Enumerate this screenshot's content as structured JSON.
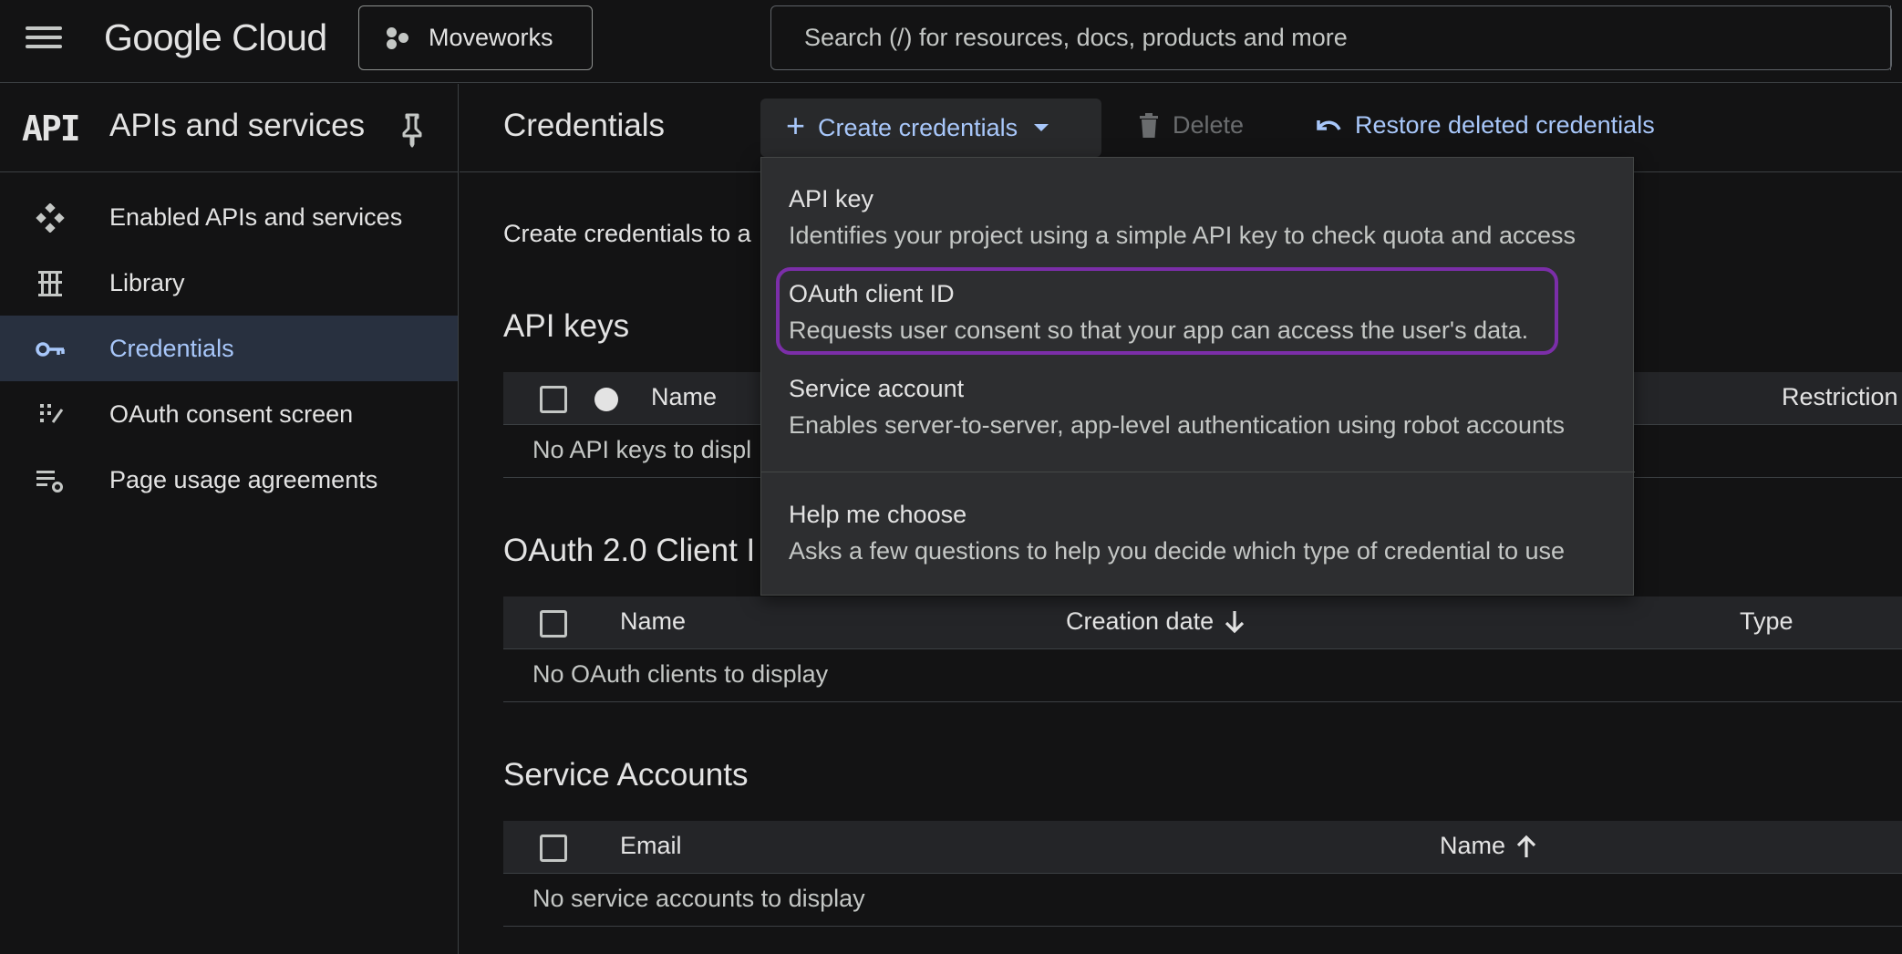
{
  "topbar": {
    "logo": "Google Cloud",
    "project": "Moveworks",
    "search_placeholder": "Search (/) for resources, docs, products and more"
  },
  "sidebar": {
    "badge": "API",
    "title": "APIs and services",
    "items": [
      {
        "label": "Enabled APIs and services",
        "icon": "diamond-grid-icon"
      },
      {
        "label": "Library",
        "icon": "library-icon"
      },
      {
        "label": "Credentials",
        "icon": "key-icon",
        "active": true
      },
      {
        "label": "OAuth consent screen",
        "icon": "consent-icon"
      },
      {
        "label": "Page usage agreements",
        "icon": "settings-list-icon"
      }
    ]
  },
  "header": {
    "title": "Credentials",
    "create_label": "Create credentials",
    "delete_label": "Delete",
    "restore_label": "Restore deleted credentials"
  },
  "intro_text": "Create credentials to a",
  "sections": {
    "api_keys": {
      "title": "API keys",
      "columns": {
        "name": "Name",
        "restrictions": "Restriction"
      },
      "empty": "No API keys to displ"
    },
    "oauth": {
      "title": "OAuth 2.0 Client I",
      "columns": {
        "name": "Name",
        "creation_date": "Creation date",
        "type": "Type"
      },
      "empty": "No OAuth clients to display"
    },
    "service_accounts": {
      "title": "Service Accounts",
      "columns": {
        "email": "Email",
        "name": "Name"
      },
      "empty": "No service accounts to display"
    }
  },
  "dropdown": {
    "items": [
      {
        "title": "API key",
        "desc": "Identifies your project using a simple API key to check quota and access"
      },
      {
        "title": "OAuth client ID",
        "desc": "Requests user consent so that your app can access the user's data.",
        "highlighted": true
      },
      {
        "title": "Service account",
        "desc": "Enables server-to-server, app-level authentication using robot accounts"
      },
      {
        "title": "Help me choose",
        "desc": "Asks a few questions to help you decide which type of credential to use"
      }
    ]
  },
  "colors": {
    "accent": "#a8c7fa",
    "active_bg": "#28303f",
    "highlight": "#7b2ea8",
    "background": "#131314"
  }
}
